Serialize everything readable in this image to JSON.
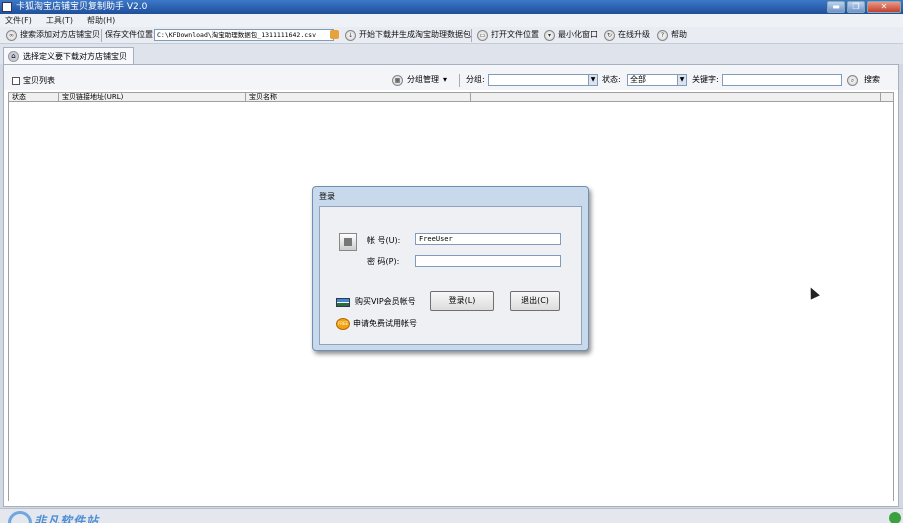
{
  "window": {
    "title": "卡狐淘宝店铺宝贝复制助手 V2.0",
    "controls": [
      "▬",
      "❐",
      "✕"
    ]
  },
  "menu": [
    "文件(F)",
    "工具(T)",
    "帮助(H)"
  ],
  "toolbar": {
    "add_label": "搜索添加对方店铺宝贝",
    "save_location_label": "保存文件位置:",
    "save_path": "C:\\KFDownload\\淘宝助理数据包_1311111642.csv",
    "start_label": "开始下载并生成淘宝助理数据包",
    "open_location_label": "打开文件位置",
    "minimize_label": "最小化窗口",
    "upgrade_label": "在线升级",
    "help_label": "帮助"
  },
  "tab": {
    "label": "选择定义要下载对方店铺宝贝"
  },
  "filter": {
    "list_label": "宝贝列表",
    "group_manage_label": "分组管理",
    "group_label": "分组:",
    "group_value": "",
    "status_label": "状态:",
    "status_value": "全部",
    "keyword_label": "关键字:",
    "keyword_value": "",
    "search_label": "搜索"
  },
  "grid": {
    "columns": [
      "状态",
      "宝贝链接地址(URL)",
      "宝贝名称",
      ""
    ]
  },
  "statusbar": {
    "watermark": "非凡软件站"
  },
  "dialog": {
    "title": "登录",
    "account_label": "帐 号(U):",
    "account_value": "FreeUser",
    "password_label": "密 码(P):",
    "password_value": "",
    "login_button": "登录(L)",
    "exit_button": "退出(C)",
    "buy_vip_label": "购买VIP会员帐号",
    "free_trial_label": "申请免费试用帐号"
  }
}
